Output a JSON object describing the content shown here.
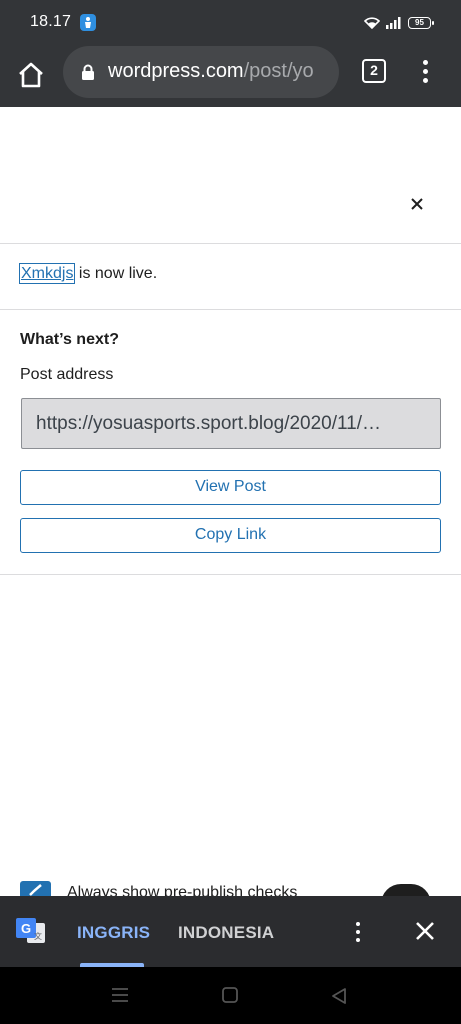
{
  "status_bar": {
    "time": "18.17",
    "battery": "95"
  },
  "browser": {
    "url_domain": "wordpress.com",
    "url_path": "/post/yo",
    "tab_count": "2"
  },
  "publish_panel": {
    "link_text": "Xmkdjs",
    "live_text": " is now live.",
    "whats_next": "What’s next?",
    "post_address_label": "Post address",
    "post_address_value": "https://yosuasports.sport.blog/2020/11/…",
    "view_post_label": "View Post",
    "copy_link_label": "Copy Link",
    "checkbox_label": "Always show pre-publish checks"
  },
  "translate_bar": {
    "lang_source": "INGGRIS",
    "lang_target": "INDONESIA"
  },
  "colors": {
    "accent": "#2271b1",
    "translate_active": "#8ab4f8",
    "chrome_bar": "#333538"
  },
  "icons": [
    "home-icon",
    "lock-icon",
    "tabs-icon",
    "more-vert-icon",
    "close-icon",
    "google-translate-icon",
    "nav-recents-icon",
    "nav-home-icon",
    "nav-back-icon"
  ]
}
